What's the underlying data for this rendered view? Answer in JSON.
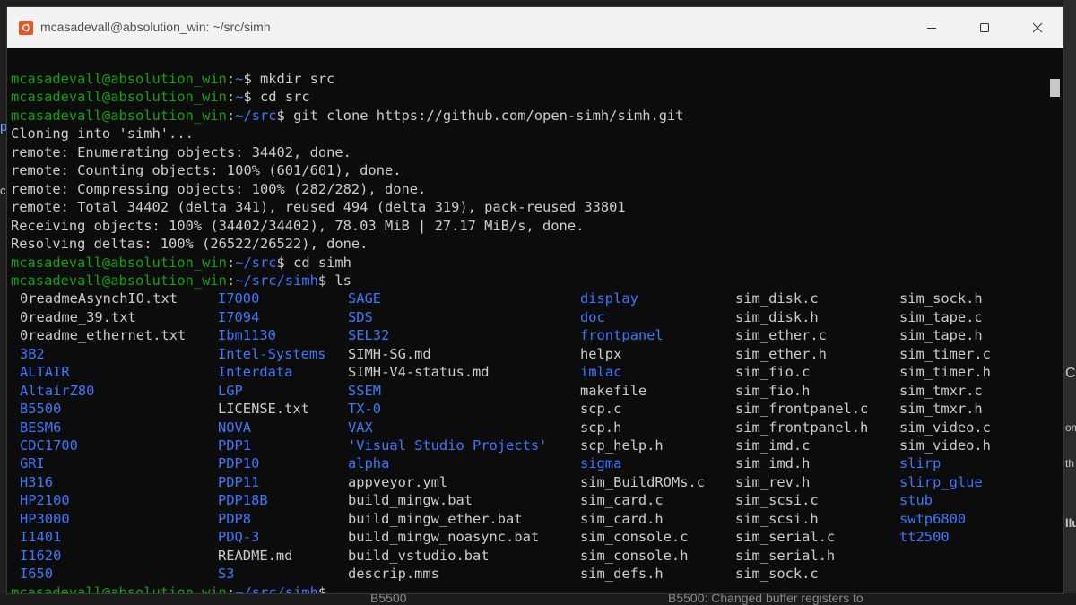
{
  "window": {
    "title": "mcasadevall@absolution_win: ~/src/simh"
  },
  "colors": {
    "prompt_user": "#13a10e",
    "prompt_path": "#3b78ff",
    "directory": "#3b78ff",
    "text": "#cccccc",
    "background": "#0c0c0c",
    "titlebar": "#f3f3f3"
  },
  "icons": {
    "app": "ubuntu-icon",
    "minimize": "minimize-icon",
    "maximize": "maximize-icon",
    "close": "close-icon"
  },
  "terminal": {
    "lines": [
      {
        "user": "mcasadevall@absolution_win",
        "sep": ":",
        "path": "~",
        "cmd": "$ mkdir src"
      },
      {
        "user": "mcasadevall@absolution_win",
        "sep": ":",
        "path": "~",
        "cmd": "$ cd src"
      },
      {
        "user": "mcasadevall@absolution_win",
        "sep": ":",
        "path": "~/src",
        "cmd": "$ git clone https://github.com/open-simh/simh.git"
      },
      {
        "text": "Cloning into 'simh'..."
      },
      {
        "text": "remote: Enumerating objects: 34402, done."
      },
      {
        "text": "remote: Counting objects: 100% (601/601), done."
      },
      {
        "text": "remote: Compressing objects: 100% (282/282), done."
      },
      {
        "text": "remote: Total 34402 (delta 341), reused 494 (delta 319), pack-reused 33801"
      },
      {
        "text": "Receiving objects: 100% (34402/34402), 78.03 MiB | 27.17 MiB/s, done."
      },
      {
        "text": "Resolving deltas: 100% (26522/26522), done."
      },
      {
        "user": "mcasadevall@absolution_win",
        "sep": ":",
        "path": "~/src",
        "cmd": "$ cd simh"
      },
      {
        "user": "mcasadevall@absolution_win",
        "sep": ":",
        "path": "~/src/simh",
        "cmd": "$ ls"
      }
    ],
    "ls_columns": [
      [
        {
          "name": "0readmeAsynchIO.txt",
          "dir": false
        },
        {
          "name": "0readme_39.txt",
          "dir": false
        },
        {
          "name": "0readme_ethernet.txt",
          "dir": false
        },
        {
          "name": "3B2",
          "dir": true
        },
        {
          "name": "ALTAIR",
          "dir": true
        },
        {
          "name": "AltairZ80",
          "dir": true
        },
        {
          "name": "B5500",
          "dir": true
        },
        {
          "name": "BESM6",
          "dir": true
        },
        {
          "name": "CDC1700",
          "dir": true
        },
        {
          "name": "GRI",
          "dir": true
        },
        {
          "name": "H316",
          "dir": true
        },
        {
          "name": "HP2100",
          "dir": true
        },
        {
          "name": "HP3000",
          "dir": true
        },
        {
          "name": "I1401",
          "dir": true
        },
        {
          "name": "I1620",
          "dir": true
        },
        {
          "name": "I650",
          "dir": true
        }
      ],
      [
        {
          "name": "I7000",
          "dir": true
        },
        {
          "name": "I7094",
          "dir": true
        },
        {
          "name": "Ibm1130",
          "dir": true
        },
        {
          "name": "Intel-Systems",
          "dir": true
        },
        {
          "name": "Interdata",
          "dir": true
        },
        {
          "name": "LGP",
          "dir": true
        },
        {
          "name": "LICENSE.txt",
          "dir": false
        },
        {
          "name": "NOVA",
          "dir": true
        },
        {
          "name": "PDP1",
          "dir": true
        },
        {
          "name": "PDP10",
          "dir": true
        },
        {
          "name": "PDP11",
          "dir": true
        },
        {
          "name": "PDP18B",
          "dir": true
        },
        {
          "name": "PDP8",
          "dir": true
        },
        {
          "name": "PDQ-3",
          "dir": true
        },
        {
          "name": "README.md",
          "dir": false
        },
        {
          "name": "S3",
          "dir": true
        }
      ],
      [
        {
          "name": "SAGE",
          "dir": true
        },
        {
          "name": "SDS",
          "dir": true
        },
        {
          "name": "SEL32",
          "dir": true
        },
        {
          "name": "SIMH-SG.md",
          "dir": false
        },
        {
          "name": "SIMH-V4-status.md",
          "dir": false
        },
        {
          "name": "SSEM",
          "dir": true
        },
        {
          "name": "TX-0",
          "dir": true
        },
        {
          "name": "VAX",
          "dir": true
        },
        {
          "name": "'Visual Studio Projects'",
          "dir": true
        },
        {
          "name": "alpha",
          "dir": true
        },
        {
          "name": "appveyor.yml",
          "dir": false
        },
        {
          "name": "build_mingw.bat",
          "dir": false
        },
        {
          "name": "build_mingw_ether.bat",
          "dir": false
        },
        {
          "name": "build_mingw_noasync.bat",
          "dir": false
        },
        {
          "name": "build_vstudio.bat",
          "dir": false
        },
        {
          "name": "descrip.mms",
          "dir": false
        }
      ],
      [
        {
          "name": "display",
          "dir": true
        },
        {
          "name": "doc",
          "dir": true
        },
        {
          "name": "frontpanel",
          "dir": true
        },
        {
          "name": "helpx",
          "dir": false
        },
        {
          "name": "imlac",
          "dir": true
        },
        {
          "name": "makefile",
          "dir": false
        },
        {
          "name": "scp.c",
          "dir": false
        },
        {
          "name": "scp.h",
          "dir": false
        },
        {
          "name": "scp_help.h",
          "dir": false
        },
        {
          "name": "sigma",
          "dir": true
        },
        {
          "name": "sim_BuildROMs.c",
          "dir": false
        },
        {
          "name": "sim_card.c",
          "dir": false
        },
        {
          "name": "sim_card.h",
          "dir": false
        },
        {
          "name": "sim_console.c",
          "dir": false
        },
        {
          "name": "sim_console.h",
          "dir": false
        },
        {
          "name": "sim_defs.h",
          "dir": false
        }
      ],
      [
        {
          "name": "sim_disk.c",
          "dir": false
        },
        {
          "name": "sim_disk.h",
          "dir": false
        },
        {
          "name": "sim_ether.c",
          "dir": false
        },
        {
          "name": "sim_ether.h",
          "dir": false
        },
        {
          "name": "sim_fio.c",
          "dir": false
        },
        {
          "name": "sim_fio.h",
          "dir": false
        },
        {
          "name": "sim_frontpanel.c",
          "dir": false
        },
        {
          "name": "sim_frontpanel.h",
          "dir": false
        },
        {
          "name": "sim_imd.c",
          "dir": false
        },
        {
          "name": "sim_imd.h",
          "dir": false
        },
        {
          "name": "sim_rev.h",
          "dir": false
        },
        {
          "name": "sim_scsi.c",
          "dir": false
        },
        {
          "name": "sim_scsi.h",
          "dir": false
        },
        {
          "name": "sim_serial.c",
          "dir": false
        },
        {
          "name": "sim_serial.h",
          "dir": false
        },
        {
          "name": "sim_sock.c",
          "dir": false
        }
      ],
      [
        {
          "name": "sim_sock.h",
          "dir": false
        },
        {
          "name": "sim_tape.c",
          "dir": false
        },
        {
          "name": "sim_tape.h",
          "dir": false
        },
        {
          "name": "sim_timer.c",
          "dir": false
        },
        {
          "name": "sim_timer.h",
          "dir": false
        },
        {
          "name": "sim_tmxr.c",
          "dir": false
        },
        {
          "name": "sim_tmxr.h",
          "dir": false
        },
        {
          "name": "sim_video.c",
          "dir": false
        },
        {
          "name": "sim_video.h",
          "dir": false
        },
        {
          "name": "slirp",
          "dir": true
        },
        {
          "name": "slirp_glue",
          "dir": true
        },
        {
          "name": "stub",
          "dir": true
        },
        {
          "name": "swtp6800",
          "dir": true
        },
        {
          "name": "tt2500",
          "dir": true
        }
      ]
    ],
    "final_prompt": {
      "user": "mcasadevall@absolution_win",
      "sep": ":",
      "path": "~/src/simh",
      "cmd": "$"
    }
  },
  "background": {
    "left_fragments": [
      "p",
      "co"
    ],
    "right_fragments": [
      "C",
      "om",
      "th",
      "llu"
    ],
    "bottom_fragments": [
      "B5500",
      "B5500: Changed buffer registers to"
    ]
  }
}
